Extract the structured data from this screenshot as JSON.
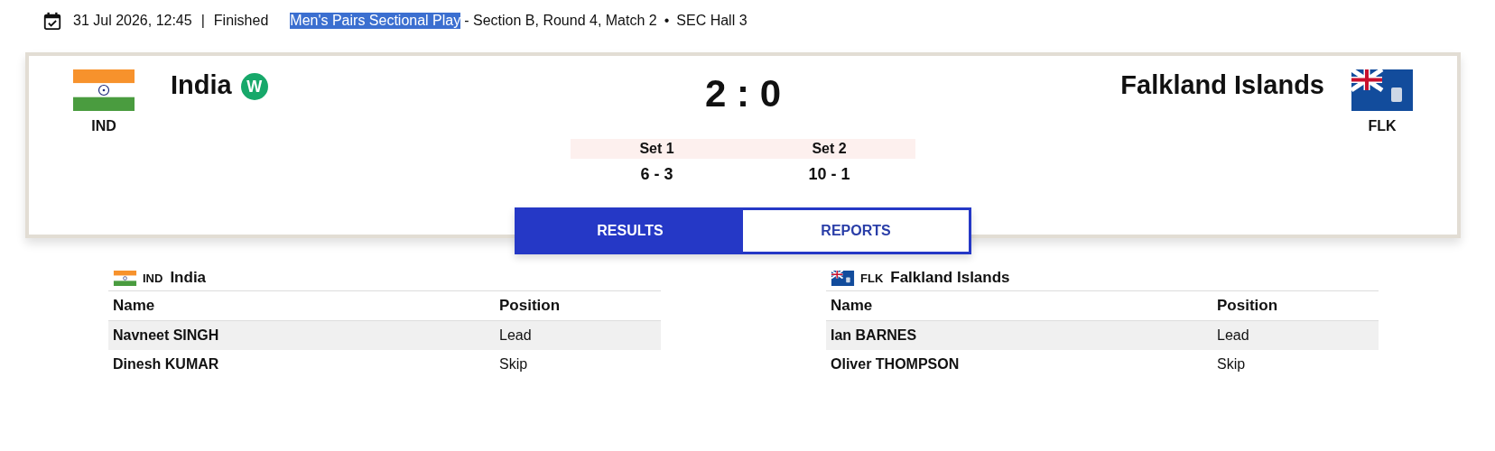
{
  "header": {
    "datetime": "31 Jul 2026, 12:45",
    "separator": "|",
    "status": "Finished",
    "event": {
      "text": "Men's Pairs Sectional Play",
      "highlighted": true
    },
    "details": "- Section B, Round 4, Match 2",
    "bullet": "•",
    "venue": "SEC Hall 3"
  },
  "match": {
    "teams": [
      {
        "name": "India",
        "code": "IND",
        "flag": {
          "kind": "india"
        },
        "badge": "W"
      },
      {
        "name": "Falkland Islands",
        "code": "FLK",
        "flag": {
          "kind": "falklands"
        }
      }
    ],
    "score": "2 : 0",
    "sets": [
      {
        "label": "Set 1",
        "score": "6 - 3"
      },
      {
        "label": "Set 2",
        "score": "10 - 1"
      }
    ]
  },
  "tabs": [
    {
      "label": "RESULTS",
      "selected": true
    },
    {
      "label": "REPORTS",
      "selected": false
    }
  ],
  "rosters": [
    {
      "code": "IND",
      "name": "India",
      "flag": {
        "kind": "india"
      },
      "columns": [
        "Name",
        "Position"
      ],
      "rows": [
        [
          "Navneet SINGH",
          "Lead"
        ],
        [
          "Dinesh KUMAR",
          "Skip"
        ]
      ]
    },
    {
      "code": "FLK",
      "name": "Falkland Islands",
      "flag": {
        "kind": "falklands"
      },
      "columns": [
        "Name",
        "Position"
      ],
      "rows": [
        [
          "Ian BARNES",
          "Lead"
        ],
        [
          "Oliver THOMPSON",
          "Skip"
        ]
      ]
    }
  ]
}
